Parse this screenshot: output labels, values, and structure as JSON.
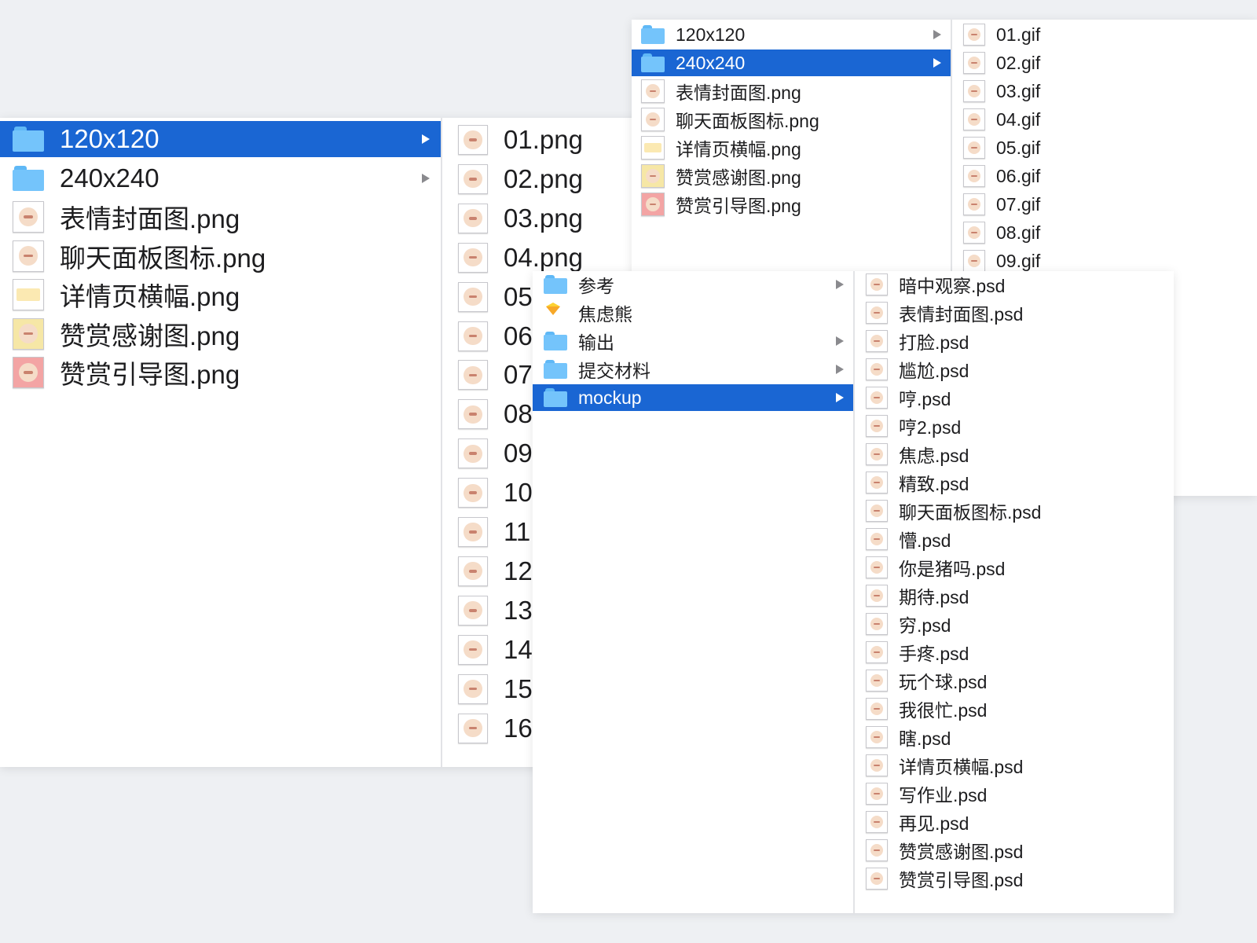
{
  "left_window": {
    "col1": [
      {
        "label": "120x120",
        "icon": "folder-icon",
        "selected": true,
        "has_children": true
      },
      {
        "label": "240x240",
        "icon": "folder-icon",
        "selected": false,
        "has_children": true
      },
      {
        "label": "表情封面图.png",
        "icon": "image-icon"
      },
      {
        "label": "聊天面板图标.png",
        "icon": "image-icon"
      },
      {
        "label": "详情页横幅.png",
        "icon": "banner-image-icon"
      },
      {
        "label": "赞赏感谢图.png",
        "icon": "image-icon-yellow"
      },
      {
        "label": "赞赏引导图.png",
        "icon": "image-icon-pink"
      }
    ],
    "col2": [
      "01.png",
      "02.png",
      "03.png",
      "04.png",
      "05",
      "06",
      "07",
      "08",
      "09",
      "10",
      "11",
      "12",
      "13",
      "14",
      "15",
      "16"
    ]
  },
  "top_window": {
    "col1": [
      {
        "label": "120x120",
        "icon": "folder-icon",
        "selected": false,
        "has_children": true
      },
      {
        "label": "240x240",
        "icon": "folder-icon",
        "selected": true,
        "has_children": true
      },
      {
        "label": "表情封面图.png",
        "icon": "image-icon"
      },
      {
        "label": "聊天面板图标.png",
        "icon": "image-icon"
      },
      {
        "label": "详情页横幅.png",
        "icon": "banner-image-icon"
      },
      {
        "label": "赞赏感谢图.png",
        "icon": "image-icon-yellow"
      },
      {
        "label": "赞赏引导图.png",
        "icon": "image-icon-pink"
      }
    ],
    "col2": [
      "01.gif",
      "02.gif",
      "03.gif",
      "04.gif",
      "05.gif",
      "06.gif",
      "07.gif",
      "08.gif",
      "09.gif"
    ]
  },
  "bottom_window": {
    "col1": [
      {
        "label": "参考",
        "icon": "folder-icon",
        "selected": false,
        "has_children": true
      },
      {
        "label": "焦虑熊",
        "icon": "sketch-file-icon",
        "selected": false,
        "has_children": false
      },
      {
        "label": "输出",
        "icon": "folder-icon",
        "selected": false,
        "has_children": true
      },
      {
        "label": "提交材料",
        "icon": "folder-icon",
        "selected": false,
        "has_children": true
      },
      {
        "label": "mockup",
        "icon": "folder-icon",
        "selected": true,
        "has_children": true
      }
    ],
    "col2": [
      "暗中观察.psd",
      "表情封面图.psd",
      "打脸.psd",
      "尴尬.psd",
      "哼.psd",
      "哼2.psd",
      "焦虑.psd",
      "精致.psd",
      "聊天面板图标.psd",
      "懵.psd",
      "你是猪吗.psd",
      "期待.psd",
      "穷.psd",
      "手疼.psd",
      "玩个球.psd",
      "我很忙.psd",
      "瞎.psd",
      "详情页横幅.psd",
      "写作业.psd",
      "再见.psd",
      "赞赏感谢图.psd",
      "赞赏引导图.psd"
    ]
  },
  "colors": {
    "selection": "#1a66d3",
    "folder": "#74c4fb",
    "background": "#eef0f3"
  }
}
